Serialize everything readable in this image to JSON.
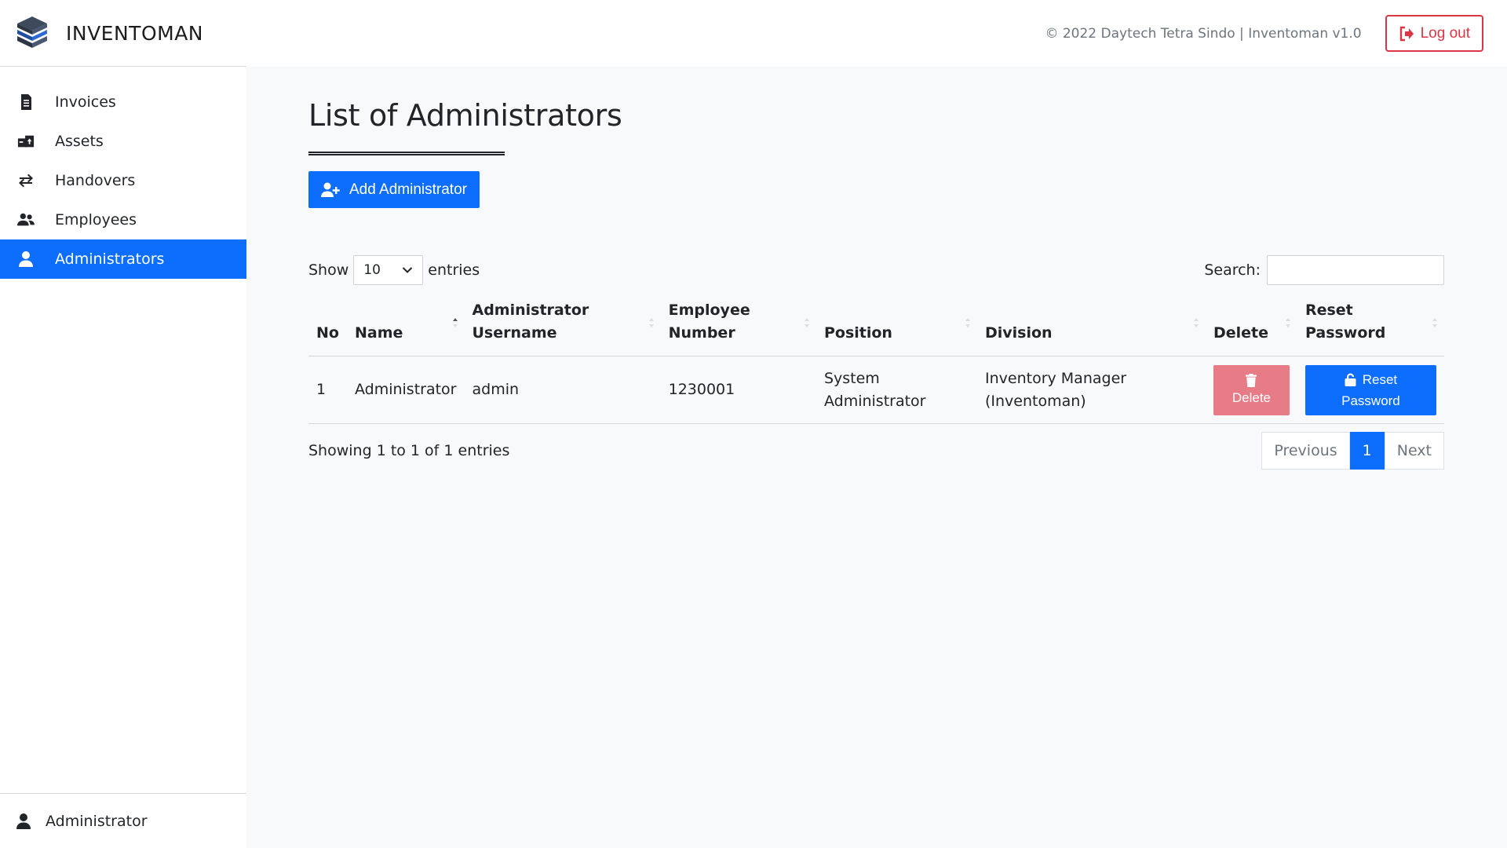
{
  "header": {
    "app_name": "INVENTOMAN",
    "copyright": "© 2022 Daytech Tetra Sindo | Inventoman v1.0",
    "logout_label": "Log out"
  },
  "sidebar": {
    "items": [
      {
        "label": "Invoices",
        "icon": "file-invoice-icon"
      },
      {
        "label": "Assets",
        "icon": "assets-icon"
      },
      {
        "label": "Handovers",
        "icon": "exchange-arrows-icon"
      },
      {
        "label": "Employees",
        "icon": "users-icon"
      },
      {
        "label": "Administrators",
        "icon": "user-tie-icon",
        "active": true
      }
    ],
    "current_user": "Administrator"
  },
  "main": {
    "title": "List of Administrators",
    "add_button_label": "Add Administrator",
    "length": {
      "show_label": "Show",
      "selected": "10",
      "entries_label": "entries"
    },
    "search": {
      "label": "Search:",
      "value": "",
      "placeholder": ""
    },
    "table": {
      "columns": [
        {
          "line1": "",
          "line2": "No"
        },
        {
          "line1": "",
          "line2": "Name"
        },
        {
          "line1": "Administrator",
          "line2": "Username"
        },
        {
          "line1": "Employee",
          "line2": "Number"
        },
        {
          "line1": "",
          "line2": "Position"
        },
        {
          "line1": "",
          "line2": "Division"
        },
        {
          "line1": "",
          "line2": "Delete"
        },
        {
          "line1": "Reset",
          "line2": "Password"
        }
      ],
      "rows": [
        {
          "no": "1",
          "name": "Administrator",
          "username": "admin",
          "employee_number": "1230001",
          "position_line1": "System",
          "position_line2": "Administrator",
          "division_line1": "Inventory Manager",
          "division_line2": "(Inventoman)",
          "delete_label": "Delete",
          "reset_line1": "Reset",
          "reset_line2": "Password"
        }
      ]
    },
    "info": "Showing 1 to 1 of 1 entries",
    "pagination": {
      "previous": "Previous",
      "current": "1",
      "next": "Next"
    }
  },
  "colors": {
    "primary": "#0d6efd",
    "danger": "#dc3545",
    "danger_disabled": "#e77c87"
  }
}
